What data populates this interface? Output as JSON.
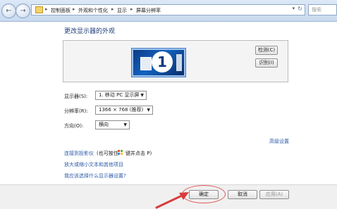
{
  "address_bar": {
    "crumbs": [
      "控制面板",
      "外观和个性化",
      "显示",
      "屏幕分辨率"
    ],
    "search_placeholder": "搜索"
  },
  "nav": {
    "back_glyph": "←",
    "forward_glyph": "→",
    "refresh_glyph": "↻",
    "dropdown_glyph": "▾",
    "separator_glyph": "▸"
  },
  "page": {
    "title": "更改显示器的外观"
  },
  "monitor": {
    "number": "1"
  },
  "buttons": {
    "detect": "检测(C)",
    "identify": "识别(I)",
    "ok": "确定",
    "cancel": "取消",
    "apply": "应用(A)"
  },
  "settings": {
    "display_label": "显示器(S):",
    "display_value": "1. 移动 PC 显示屏",
    "resolution_label": "分辨率(R):",
    "resolution_value": "1366 × 768 (推荐)",
    "orientation_label": "方向(O):",
    "orientation_value": "横向"
  },
  "links": {
    "advanced": "高级设置",
    "projector_prefix": "连接到投影仪",
    "projector_suffix": "(也可按住",
    "projector_tail": "键并点击 P)",
    "text_size": "放大或缩小文本和其他项目",
    "help": "我应该选择什么显示器设置?"
  },
  "colors": {
    "title": "#1e3d78",
    "link": "#2c5aa8",
    "highlight": "#e05a5a"
  }
}
